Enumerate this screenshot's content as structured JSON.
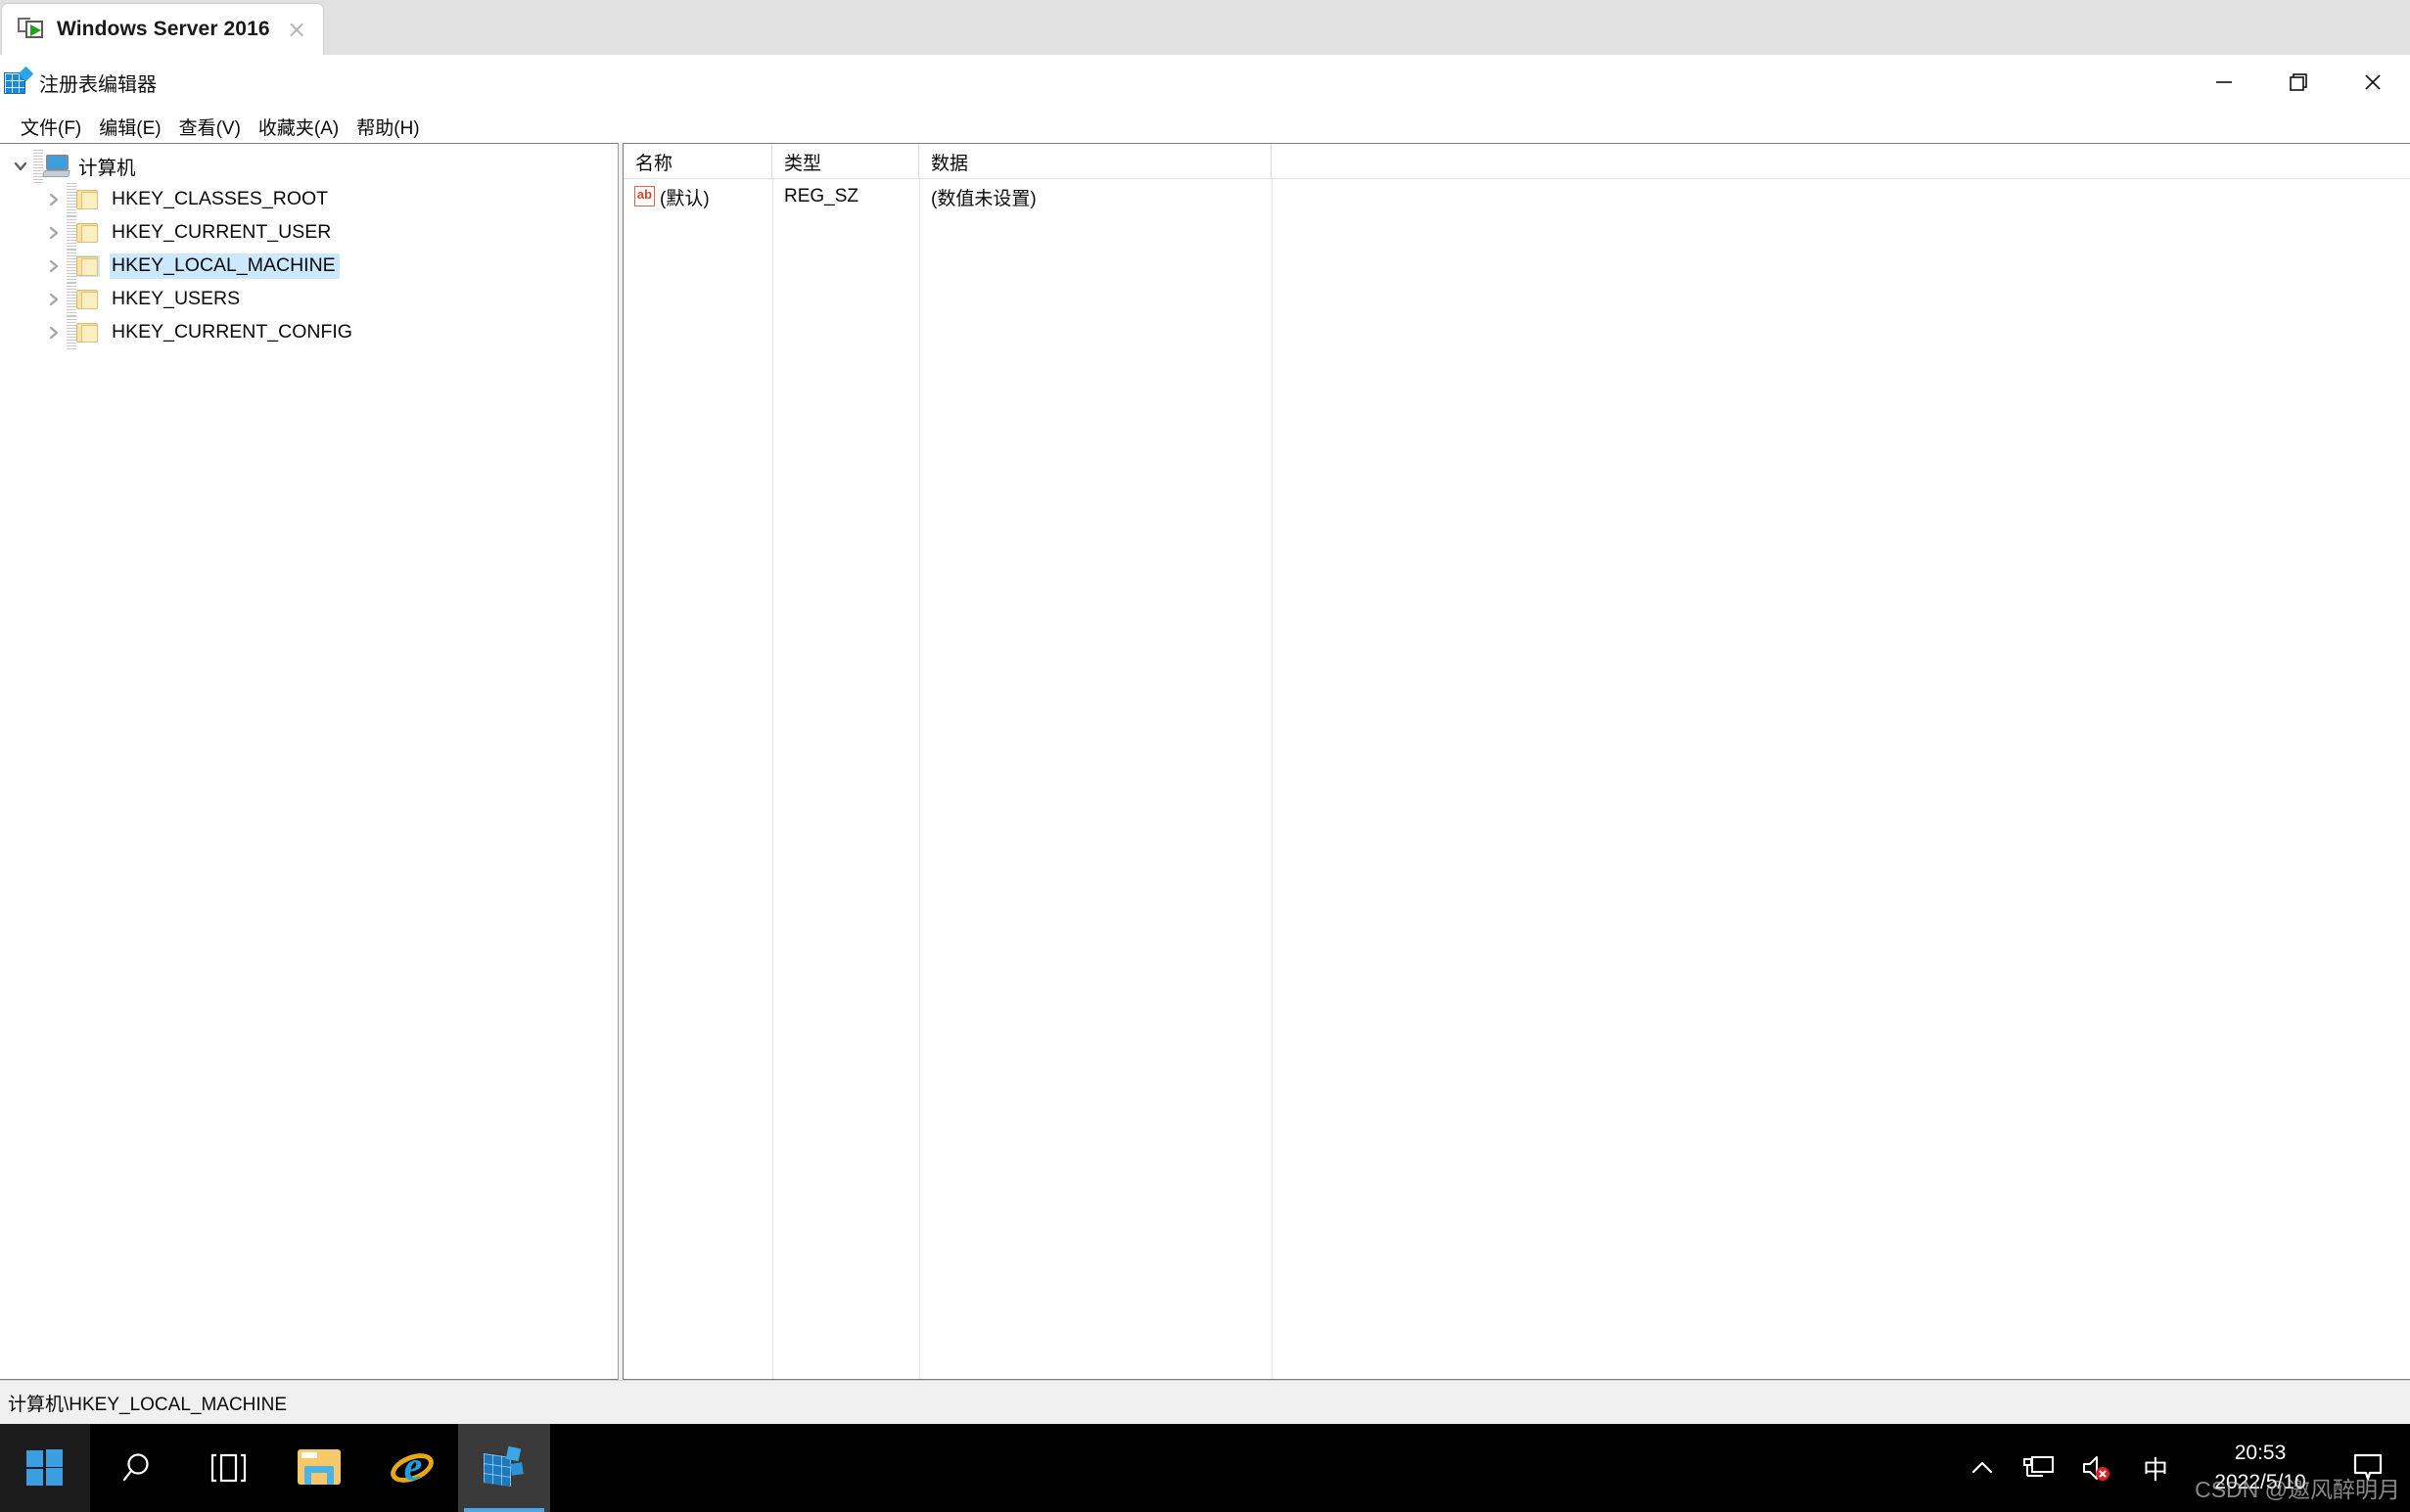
{
  "vm_tab": {
    "title": "Windows Server 2016",
    "icon": "virtual-machine-icon",
    "close_label": "×"
  },
  "window": {
    "title": "注册表编辑器",
    "icon": "registry-editor-icon",
    "controls": {
      "minimize": "minimize-button",
      "restore": "restore-button",
      "close": "close-button"
    }
  },
  "menubar": {
    "items": [
      {
        "label": "文件(F)",
        "name": "menu-file"
      },
      {
        "label": "编辑(E)",
        "name": "menu-edit"
      },
      {
        "label": "查看(V)",
        "name": "menu-view"
      },
      {
        "label": "收藏夹(A)",
        "name": "menu-favorites"
      },
      {
        "label": "帮助(H)",
        "name": "menu-help"
      }
    ]
  },
  "tree": {
    "root": {
      "label": "计算机",
      "expanded": true
    },
    "items": [
      {
        "label": "HKEY_CLASSES_ROOT",
        "selected": false
      },
      {
        "label": "HKEY_CURRENT_USER",
        "selected": false
      },
      {
        "label": "HKEY_LOCAL_MACHINE",
        "selected": true
      },
      {
        "label": "HKEY_USERS",
        "selected": false
      },
      {
        "label": "HKEY_CURRENT_CONFIG",
        "selected": false
      }
    ]
  },
  "list": {
    "columns": [
      {
        "label": "名称"
      },
      {
        "label": "类型"
      },
      {
        "label": "数据"
      }
    ],
    "rows": [
      {
        "icon": "string-value-icon",
        "icon_text": "ab",
        "name": "(默认)",
        "type": "REG_SZ",
        "data": "(数值未设置)"
      }
    ]
  },
  "statusbar": {
    "path": "计算机\\HKEY_LOCAL_MACHINE"
  },
  "taskbar": {
    "start": "windows-start-button",
    "buttons": [
      {
        "name": "search-button",
        "icon": "search-icon"
      },
      {
        "name": "task-view-button",
        "icon": "task-view-icon"
      },
      {
        "name": "file-explorer-button",
        "icon": "folder-icon"
      },
      {
        "name": "internet-explorer-button",
        "icon": "internet-explorer-icon"
      },
      {
        "name": "registry-editor-button",
        "icon": "registry-cube-icon",
        "active": true
      }
    ],
    "tray": {
      "overflow": "chevron-up-icon",
      "network": "network-icon",
      "volume": "volume-muted-icon",
      "ime": "中",
      "time": "20:53",
      "date": "2022/5/10",
      "action_center": "action-center-icon"
    }
  },
  "watermark": "CSDN @邀风醉明月",
  "colors": {
    "selection": "#cce8ff",
    "accent": "#1b79c0",
    "taskbar": "#000000",
    "tabstrip": "#e1e1e1"
  }
}
